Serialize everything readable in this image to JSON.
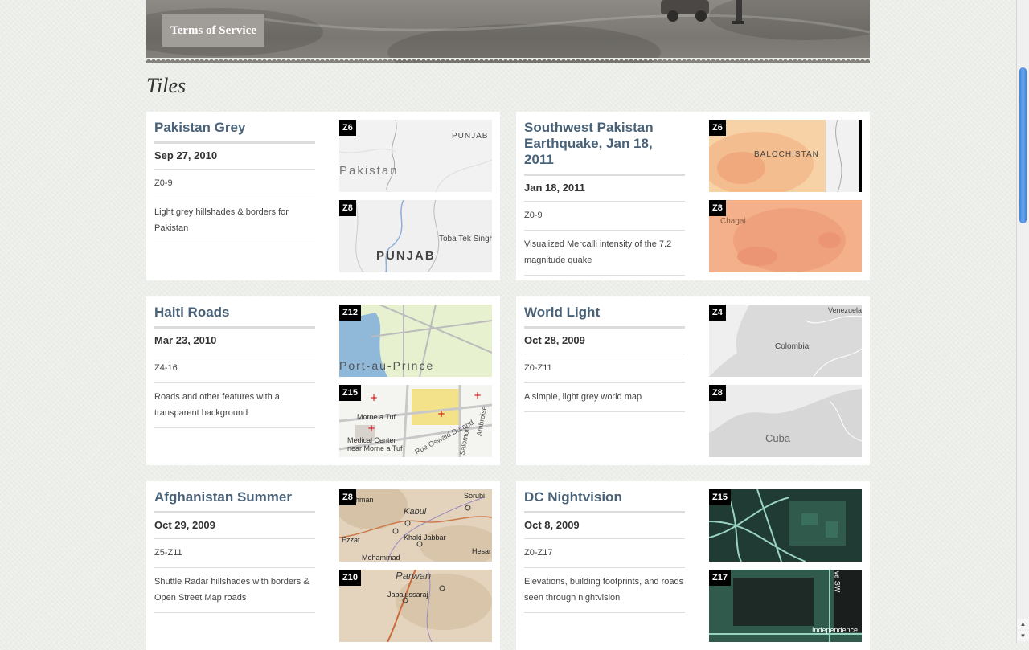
{
  "header": {
    "tos_label": "Terms of Service"
  },
  "page_title": "Tiles",
  "tiles": [
    {
      "title": "Pakistan Grey",
      "date": "Sep 27, 2010",
      "zoom_range": "Z0-9",
      "description": "Light grey hillshades & borders for Pakistan",
      "thumbs": [
        {
          "zoom": "Z6",
          "labels": [
            "PUNJAB",
            "Pakistan"
          ]
        },
        {
          "zoom": "Z8",
          "labels": [
            "Toba Tek Singh",
            "PUNJAB"
          ]
        }
      ]
    },
    {
      "title": "Southwest Pakistan Earthquake, Jan 18, 2011",
      "date": "Jan 18, 2011",
      "zoom_range": "Z0-9",
      "description": "Visualized Mercalli intensity of the 7.2 magnitude quake",
      "thumbs": [
        {
          "zoom": "Z6",
          "labels": [
            "BALOCHISTAN"
          ]
        },
        {
          "zoom": "Z8",
          "labels": [
            "Chagai"
          ]
        }
      ]
    },
    {
      "title": "Haiti Roads",
      "date": "Mar 23, 2010",
      "zoom_range": "Z4-16",
      "description": "Roads and other features with a transparent background",
      "thumbs": [
        {
          "zoom": "Z12",
          "labels": [
            "Port-au-Prince"
          ]
        },
        {
          "zoom": "Z15",
          "labels": [
            "Morne a Tuf",
            "Medical Center near Morne a Tuf",
            "Rue Oswald Durand",
            "Salomon",
            "Ambroise"
          ]
        }
      ]
    },
    {
      "title": "World Light",
      "date": "Oct 28, 2009",
      "zoom_range": "Z0-Z11",
      "description": "A simple, light grey world map",
      "thumbs": [
        {
          "zoom": "Z4",
          "labels": [
            "Venezuela",
            "Colombia"
          ]
        },
        {
          "zoom": "Z8",
          "labels": [
            "Cuba"
          ]
        }
      ]
    },
    {
      "title": "Afghanistan Summer",
      "date": "Oct 29, 2009",
      "zoom_range": "Z5-Z11",
      "description": "Shuttle Radar hillshades with borders & Open Street Map roads",
      "thumbs": [
        {
          "zoom": "Z8",
          "labels": [
            "hman",
            "Sorubi",
            "Kabul",
            "Khaki Jabbar",
            "Ezzat",
            "Hesar",
            "Mohammad"
          ]
        },
        {
          "zoom": "Z10",
          "labels": [
            "Parwan",
            "Jabalussaraj"
          ]
        }
      ]
    },
    {
      "title": "DC Nightvision",
      "date": "Oct 8, 2009",
      "zoom_range": "Z0-Z17",
      "description": "Elevations, building footprints, and roads seen through nightvision",
      "thumbs": [
        {
          "zoom": "Z15",
          "labels": []
        },
        {
          "zoom": "Z17",
          "labels": [
            "Independence",
            "ve SW"
          ]
        }
      ]
    }
  ],
  "colors": {
    "title_link": "#4a6278",
    "hero": "#8d8a85",
    "scroll_thumb": "#3f82d6",
    "nightvision": "#2f5a4c",
    "quake": "#f3b08a"
  }
}
